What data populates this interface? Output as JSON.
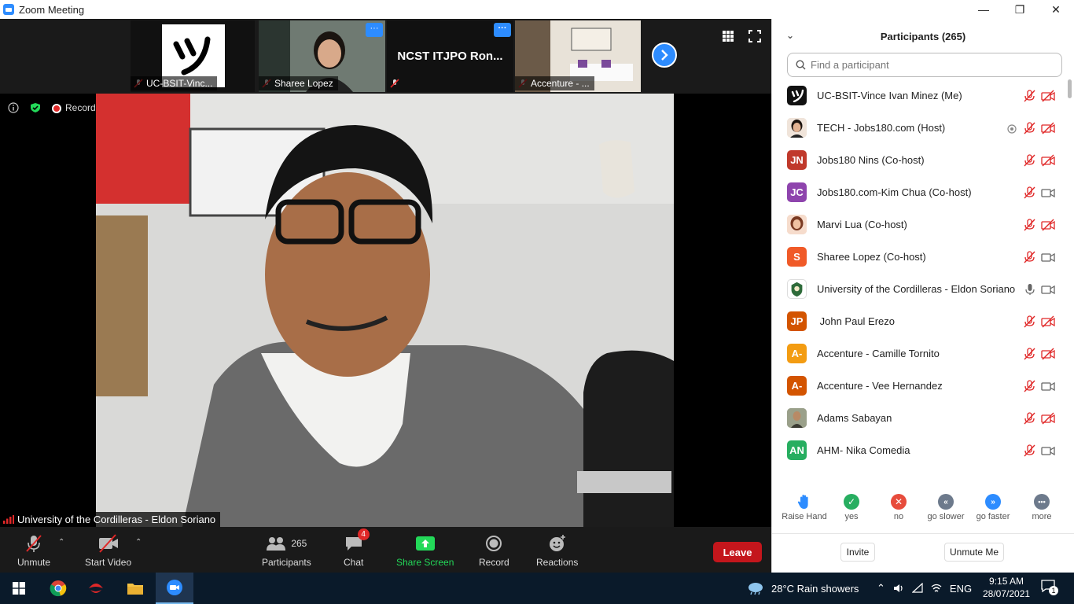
{
  "window": {
    "title": "Zoom Meeting"
  },
  "thumbnails": [
    {
      "name": "UC-BSIT-Vinc..."
    },
    {
      "name": "Sharee Lopez"
    },
    {
      "name": "NCST  ITJPO Ron..."
    },
    {
      "name": "Accenture - ..."
    }
  ],
  "thumb_more_label": "···",
  "status": {
    "recording_label": "Recording"
  },
  "active_speaker": {
    "name": "University of the Cordilleras - Eldon Soriano"
  },
  "toolbar": {
    "unmute": "Unmute",
    "start_video": "Start Video",
    "participants": "Participants",
    "participants_count": "265",
    "chat": "Chat",
    "chat_badge": "4",
    "share_screen": "Share Screen",
    "record": "Record",
    "reactions": "Reactions",
    "leave": "Leave"
  },
  "panel": {
    "title": "Participants (265)",
    "search_placeholder": "Find a participant",
    "participants": [
      {
        "name": "UC-BSIT-Vince Ivan Minez (Me)",
        "avatar": "",
        "avatar_color": "#111111"
      },
      {
        "name": "TECH - Jobs180.com (Host)",
        "avatar": "",
        "avatar_color": "#c89a7a"
      },
      {
        "name": "Jobs180 Nins (Co-host)",
        "avatar": "JN",
        "avatar_color": "#c0392b"
      },
      {
        "name": "Jobs180.com-Kim Chua (Co-host)",
        "avatar": "JC",
        "avatar_color": "#8e44ad"
      },
      {
        "name": "Marvi Lua (Co-host)",
        "avatar": "",
        "avatar_color": "#d4a088"
      },
      {
        "name": "Sharee Lopez (Co-host)",
        "avatar": "S",
        "avatar_color": "#f05a28"
      },
      {
        "name": "University of the Cordilleras - Eldon Soriano",
        "avatar": "",
        "avatar_color": "#2e6b3a"
      },
      {
        "name": " John Paul Erezo",
        "avatar": "JP",
        "avatar_color": "#d35400"
      },
      {
        "name": "Accenture - Camille Tornito",
        "avatar": "A-",
        "avatar_color": "#f39c12"
      },
      {
        "name": "Accenture - Vee Hernandez",
        "avatar": "A-",
        "avatar_color": "#d35400"
      },
      {
        "name": "Adams Sabayan",
        "avatar": "",
        "avatar_color": "#8a8a7a"
      },
      {
        "name": "AHM- Nika Comedia",
        "avatar": "AN",
        "avatar_color": "#27ae60"
      }
    ],
    "reactions": [
      {
        "label": "Raise Hand",
        "icon": "raise-hand",
        "color": "#2d8cff"
      },
      {
        "label": "yes",
        "icon": "check",
        "color": "#27ae60"
      },
      {
        "label": "no",
        "icon": "x",
        "color": "#e74c3c"
      },
      {
        "label": "go slower",
        "icon": "rewind",
        "color": "#6d7a8c"
      },
      {
        "label": "go faster",
        "icon": "fast-forward",
        "color": "#2d8cff"
      },
      {
        "label": "more",
        "icon": "more",
        "color": "#6d7a8c"
      }
    ],
    "invite": "Invite",
    "unmute_me": "Unmute Me"
  },
  "taskbar": {
    "weather": "28°C  Rain showers",
    "lang": "ENG",
    "time": "9:15 AM",
    "date": "28/07/2021",
    "notifications": "1"
  }
}
